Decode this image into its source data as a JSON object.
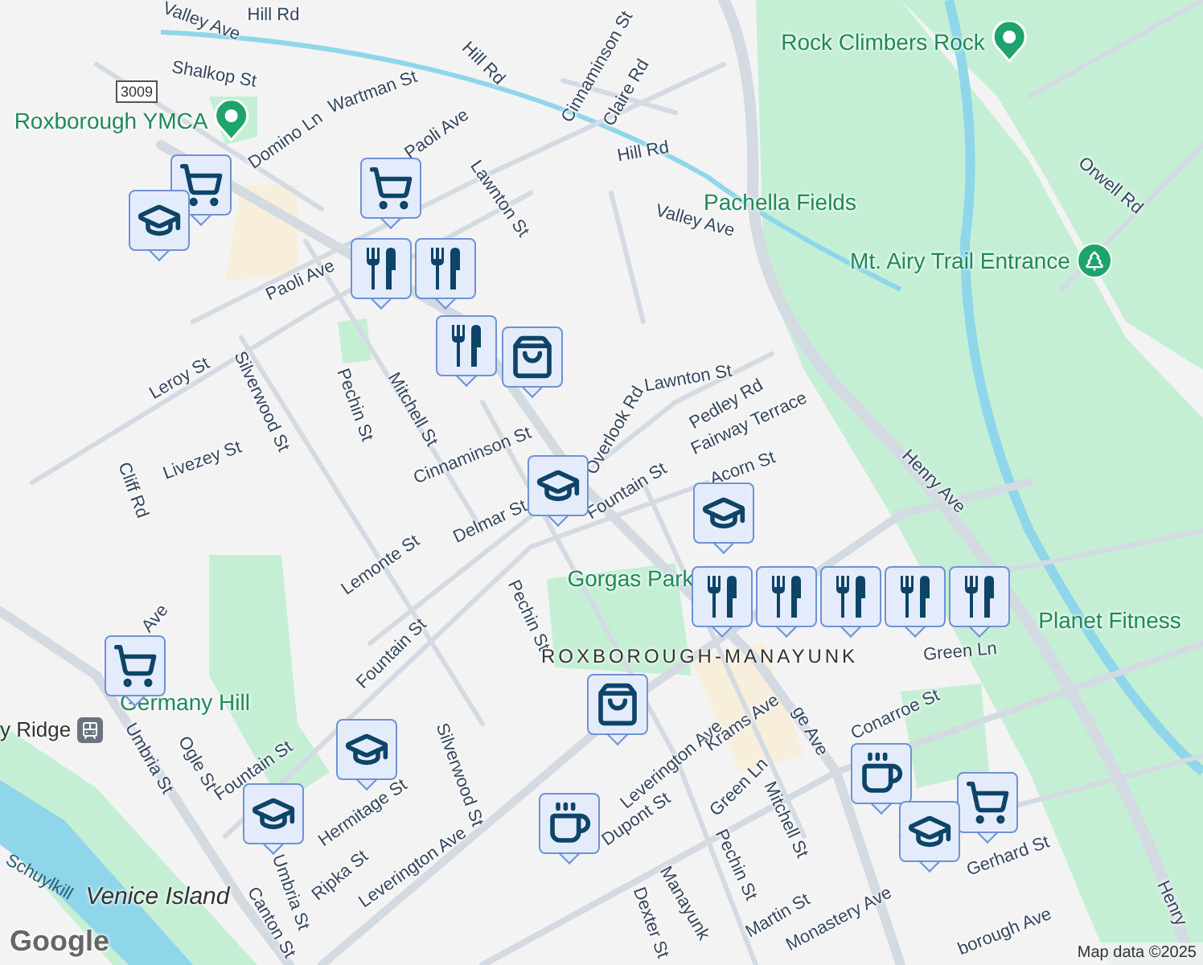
{
  "streets": [
    "Valley Ave",
    "Hill Rd",
    "Shalkop St",
    "Domino Ln",
    "Wartman St",
    "Paoli Ave",
    "Lawnton St",
    "Paoli Ave",
    "Mitchell St",
    "Pechin St",
    "Leroy St",
    "Silverwood St",
    "Livezey St",
    "Cliff Rd",
    "Cinnaminson St",
    "Delmar St",
    "Lemonte St",
    "Fountain St",
    "Overlook Rd",
    "Lawnton St",
    "Pedley Rd",
    "Fairway Terrace",
    "Acorn St",
    "Henry Ave",
    "Orwell Rd",
    "Valley Ave",
    "Hill Rd",
    "Cinnaminson St",
    "Claire Rd",
    "Hill Rd",
    "Pechin St",
    "Fountain St",
    "Fountain St",
    "Silverwood St",
    "Ogle St",
    "Umbria St",
    "Umbria St",
    "Hermitage St",
    "Ripka St",
    "Canton St",
    "Leverington Ave",
    "Leverington Ave",
    "Krams Ave",
    "ge Ave",
    "Conarroe St",
    "Green Ln",
    "Green Ln",
    "Dupont St",
    "Mitchell St",
    "Pechin St",
    "Gerhard St",
    "Manayunk",
    "Dexter St",
    "Martin St",
    "Monastery Ave",
    "borough Ave",
    "Henry",
    "Ave"
  ],
  "places": [
    {
      "name": "Roxborough YMCA",
      "kind": "poi"
    },
    {
      "name": "Rock Climbers Rock",
      "kind": "poi"
    },
    {
      "name": "Mt. Airy Trail Entrance",
      "kind": "trail"
    },
    {
      "name": "Pachella Fields",
      "kind": "park"
    },
    {
      "name": "Gorgas Park",
      "kind": "park"
    },
    {
      "name": "Germany Hill",
      "kind": "park"
    },
    {
      "name": "Planet Fitness",
      "kind": "park"
    },
    {
      "name": "ROXBOROUGH-MANAYUNK",
      "kind": "area"
    },
    {
      "name": "Venice Island",
      "kind": "island"
    },
    {
      "name": "Schuylkill",
      "kind": "water"
    },
    {
      "name": "y Ridge",
      "kind": "station"
    }
  ],
  "route_shield": "3009",
  "markers": [
    {
      "kind": "cart"
    },
    {
      "kind": "school"
    },
    {
      "kind": "cart"
    },
    {
      "kind": "food"
    },
    {
      "kind": "food"
    },
    {
      "kind": "food"
    },
    {
      "kind": "bag"
    },
    {
      "kind": "school"
    },
    {
      "kind": "school"
    },
    {
      "kind": "food"
    },
    {
      "kind": "food"
    },
    {
      "kind": "food"
    },
    {
      "kind": "food"
    },
    {
      "kind": "food"
    },
    {
      "kind": "cart"
    },
    {
      "kind": "school"
    },
    {
      "kind": "school"
    },
    {
      "kind": "bag"
    },
    {
      "kind": "cup"
    },
    {
      "kind": "cup"
    },
    {
      "kind": "cart"
    },
    {
      "kind": "school"
    }
  ],
  "logo": "Google",
  "attribution": "Map data ©2025"
}
